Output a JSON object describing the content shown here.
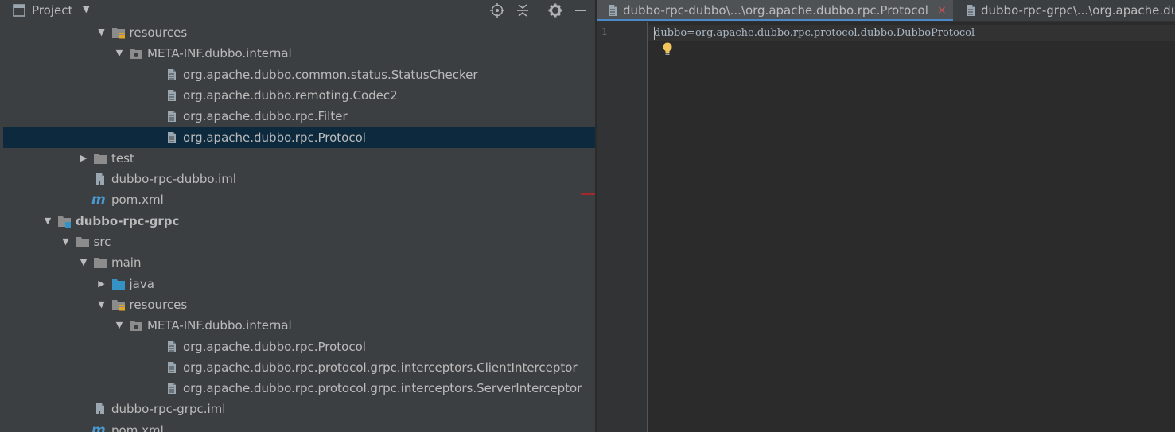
{
  "project_panel": {
    "title": "Project",
    "header_icons": [
      "locate-target-icon",
      "collapse-all-icon",
      "gear-icon",
      "minimize-icon"
    ]
  },
  "tree": [
    {
      "label": "resources",
      "arrow": "expanded",
      "icon": "resources-folder-icon",
      "depth": 5
    },
    {
      "label": "META-INF.dubbo.internal",
      "arrow": "expanded",
      "icon": "package-folder-icon",
      "depth": 6
    },
    {
      "label": "org.apache.dubbo.common.status.StatusChecker",
      "arrow": "none",
      "icon": "file-icon",
      "depth": 8
    },
    {
      "label": "org.apache.dubbo.remoting.Codec2",
      "arrow": "none",
      "icon": "file-icon",
      "depth": 8
    },
    {
      "label": "org.apache.dubbo.rpc.Filter",
      "arrow": "none",
      "icon": "file-icon",
      "depth": 8
    },
    {
      "label": "org.apache.dubbo.rpc.Protocol",
      "arrow": "none",
      "icon": "file-icon",
      "depth": 8,
      "selected": true
    },
    {
      "label": "test",
      "arrow": "collapsed",
      "icon": "folder-icon",
      "depth": 4
    },
    {
      "label": "dubbo-rpc-dubbo.iml",
      "arrow": "none",
      "icon": "iml-file-icon",
      "depth": 4
    },
    {
      "label": "pom.xml",
      "arrow": "none",
      "icon": "maven-icon",
      "depth": 4
    },
    {
      "label": "dubbo-rpc-grpc",
      "arrow": "expanded",
      "icon": "module-folder-icon",
      "depth": 2,
      "bold": true
    },
    {
      "label": "src",
      "arrow": "expanded",
      "icon": "folder-icon",
      "depth": 3
    },
    {
      "label": "main",
      "arrow": "expanded",
      "icon": "folder-icon",
      "depth": 4
    },
    {
      "label": "java",
      "arrow": "collapsed",
      "icon": "source-folder-icon",
      "depth": 5
    },
    {
      "label": "resources",
      "arrow": "expanded",
      "icon": "resources-folder-icon",
      "depth": 5
    },
    {
      "label": "META-INF.dubbo.internal",
      "arrow": "expanded",
      "icon": "package-folder-icon",
      "depth": 6
    },
    {
      "label": "org.apache.dubbo.rpc.Protocol",
      "arrow": "none",
      "icon": "file-icon",
      "depth": 8
    },
    {
      "label": "org.apache.dubbo.rpc.protocol.grpc.interceptors.ClientInterceptor",
      "arrow": "none",
      "icon": "file-icon",
      "depth": 8
    },
    {
      "label": "org.apache.dubbo.rpc.protocol.grpc.interceptors.ServerInterceptor",
      "arrow": "none",
      "icon": "file-icon",
      "depth": 8
    },
    {
      "label": "dubbo-rpc-grpc.iml",
      "arrow": "none",
      "icon": "iml-file-icon",
      "depth": 4
    },
    {
      "label": "pom.xml",
      "arrow": "none",
      "icon": "maven-icon",
      "depth": 4
    }
  ],
  "editor": {
    "tabs": [
      {
        "label": "dubbo-rpc-dubbo\\...\\org.apache.dubbo.rpc.Protocol",
        "active": true,
        "close": "×"
      },
      {
        "label": "dubbo-rpc-grpc\\...\\org.apache.dubbo.rpc.Protocol",
        "active": false
      }
    ],
    "line_number": "1",
    "code_line": "dubbo=org.apache.dubbo.rpc.protocol.dubbo.DubboProtocol",
    "intention_icon": "lightbulb-icon"
  },
  "colors": {
    "panel_bg": "#3c3f41",
    "editor_bg": "#2b2b2b",
    "selection": "#0d293e",
    "text": "#bbbbbb",
    "accent": "#4a88c7"
  }
}
